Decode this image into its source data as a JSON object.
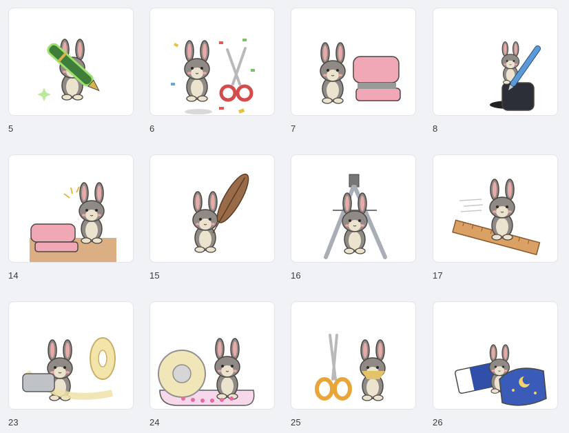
{
  "stickers": [
    {
      "number": "5",
      "icon": "bunny-fountain-pen-icon"
    },
    {
      "number": "6",
      "icon": "bunny-scissors-confetti-icon"
    },
    {
      "number": "7",
      "icon": "bunny-stapler-icon"
    },
    {
      "number": "8",
      "icon": "bunny-ink-bottle-icon"
    },
    {
      "number": "14",
      "icon": "bunny-stapler-desk-icon"
    },
    {
      "number": "15",
      "icon": "bunny-quill-icon"
    },
    {
      "number": "16",
      "icon": "bunny-compass-icon"
    },
    {
      "number": "17",
      "icon": "bunny-ruler-icon"
    },
    {
      "number": "23",
      "icon": "bunny-tape-tangle-icon"
    },
    {
      "number": "24",
      "icon": "bunny-tape-dispenser-icon"
    },
    {
      "number": "25",
      "icon": "bunny-scissors-icon"
    },
    {
      "number": "26",
      "icon": "bunny-eraser-blanket-icon"
    }
  ]
}
